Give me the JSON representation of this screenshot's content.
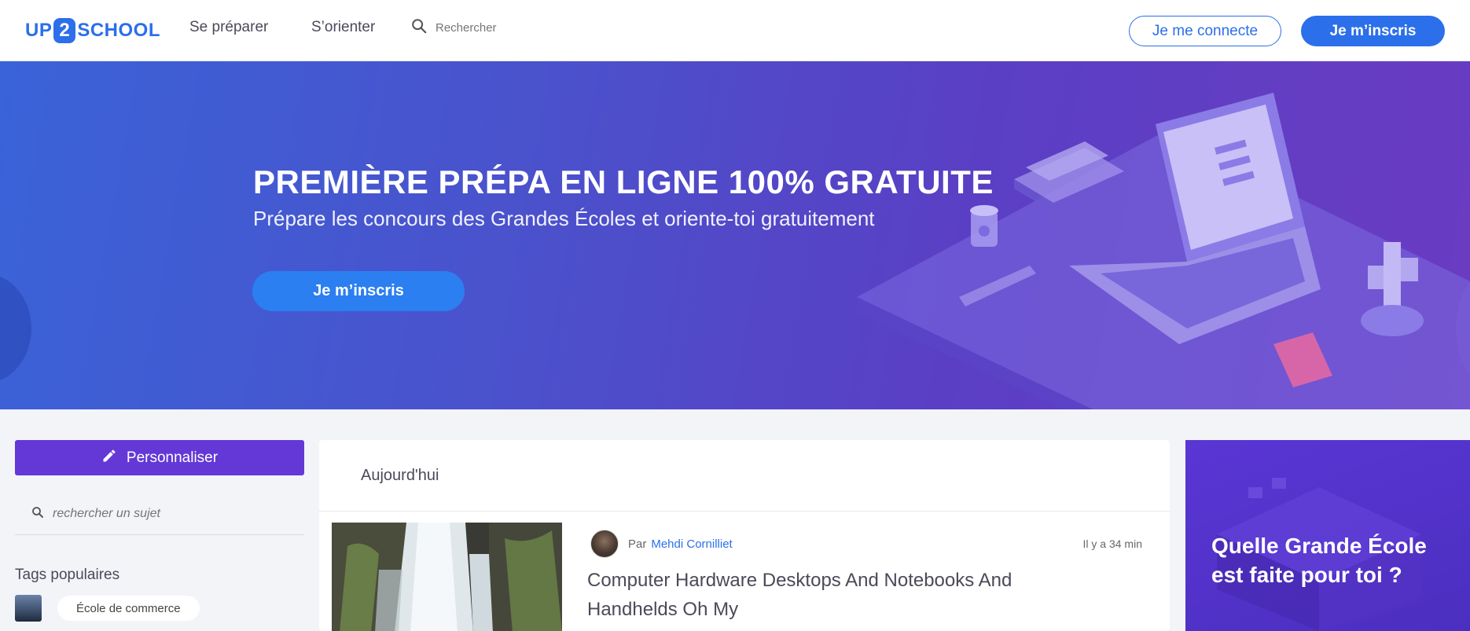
{
  "header": {
    "logo": {
      "part1": "UP",
      "part2": "2",
      "part3": "SCHOOL"
    },
    "nav": [
      {
        "label": "Se préparer"
      },
      {
        "label": "S’orienter"
      }
    ],
    "search": {
      "placeholder": "Rechercher"
    },
    "login_label": "Je me connecte",
    "signup_label": "Je m’inscris"
  },
  "hero": {
    "title": "PREMIÈRE PRÉPA EN LIGNE 100% GRATUITE",
    "subtitle": "Prépare les concours des Grandes Écoles et oriente-toi gratuitement",
    "cta_label": "Je m’inscris"
  },
  "sidebar": {
    "personalize_label": "Personnaliser",
    "topic_search": {
      "placeholder": "rechercher un sujet"
    },
    "tags_title": "Tags populaires",
    "tags": [
      {
        "label": "École de commerce"
      }
    ]
  },
  "feed": {
    "section_title": "Aujourd'hui",
    "articles": [
      {
        "by_prefix": "Par",
        "author": "Mehdi Cornilliet",
        "time": "Il y a 34 min",
        "title": "Computer Hardware Desktops And Notebooks And Handhelds Oh My"
      }
    ]
  },
  "promo": {
    "title": "Quelle Grande École est faite pour toi ?"
  },
  "colors": {
    "brand_blue": "#2b6fea",
    "purple": "#6338d6",
    "hero_start": "#3a63d8",
    "hero_end": "#6a3cc2"
  },
  "icons": [
    "search-icon",
    "pencil-icon",
    "search-icon-small"
  ]
}
